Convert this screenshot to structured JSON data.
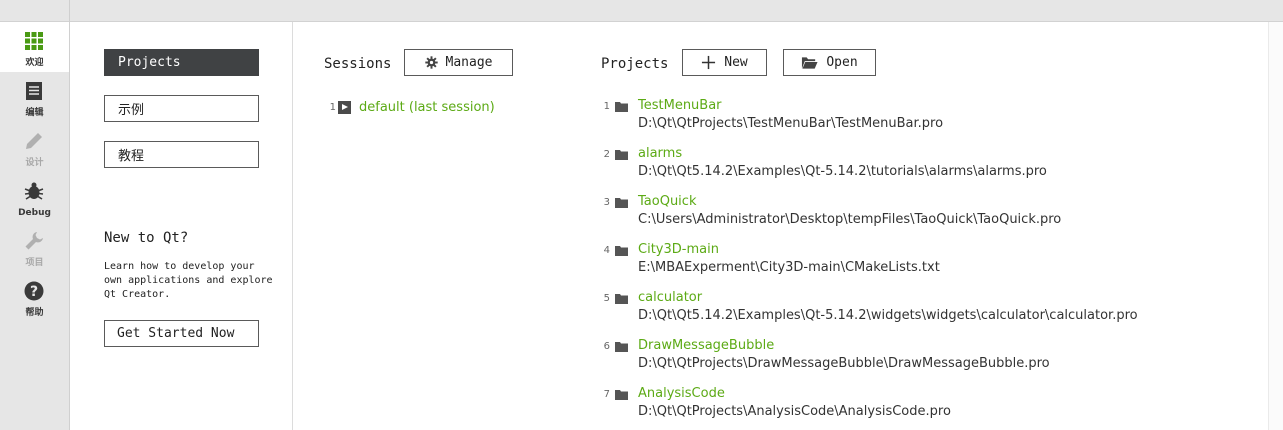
{
  "sidebar": {
    "modes": [
      {
        "label": "欢迎",
        "icon": "grid-icon",
        "active": true
      },
      {
        "label": "编辑",
        "icon": "document-icon",
        "active": false
      },
      {
        "label": "设计",
        "icon": "pencil-icon",
        "active": false,
        "disabled": true
      },
      {
        "label": "Debug",
        "icon": "bug-icon",
        "active": false
      },
      {
        "label": "项目",
        "icon": "wrench-icon",
        "active": false,
        "disabled": true
      },
      {
        "label": "帮助",
        "icon": "help-icon",
        "active": false
      }
    ]
  },
  "welcome": {
    "projects_btn": "Projects",
    "examples_btn": "示例",
    "tutorials_btn": "教程",
    "new_title": "New to Qt?",
    "new_desc": "Learn how to develop your own applications and explore Qt Creator.",
    "get_started": "Get Started Now"
  },
  "sessions": {
    "title": "Sessions",
    "manage_label": "Manage",
    "items": [
      {
        "index": "1",
        "name": "default (last session)"
      }
    ]
  },
  "projects": {
    "title": "Projects",
    "new_label": "New",
    "open_label": "Open",
    "items": [
      {
        "index": "1",
        "name": "TestMenuBar",
        "path": "D:\\Qt\\QtProjects\\TestMenuBar\\TestMenuBar.pro"
      },
      {
        "index": "2",
        "name": "alarms",
        "path": "D:\\Qt\\Qt5.14.2\\Examples\\Qt-5.14.2\\tutorials\\alarms\\alarms.pro"
      },
      {
        "index": "3",
        "name": "TaoQuick",
        "path": "C:\\Users\\Administrator\\Desktop\\tempFiles\\TaoQuick\\TaoQuick.pro"
      },
      {
        "index": "4",
        "name": "City3D-main",
        "path": "E:\\MBAExperment\\City3D-main\\CMakeLists.txt"
      },
      {
        "index": "5",
        "name": "calculator",
        "path": "D:\\Qt\\Qt5.14.2\\Examples\\Qt-5.14.2\\widgets\\widgets\\calculator\\calculator.pro"
      },
      {
        "index": "6",
        "name": "DrawMessageBubble",
        "path": "D:\\Qt\\QtProjects\\DrawMessageBubble\\DrawMessageBubble.pro"
      },
      {
        "index": "7",
        "name": "AnalysisCode",
        "path": "D:\\Qt\\QtProjects\\AnalysisCode\\AnalysisCode.pro"
      }
    ]
  },
  "colors": {
    "link": "#5caa15",
    "dark_button": "#404244",
    "sidebar_bg": "#e6e6e6",
    "active_icon": "#4a9a14"
  }
}
